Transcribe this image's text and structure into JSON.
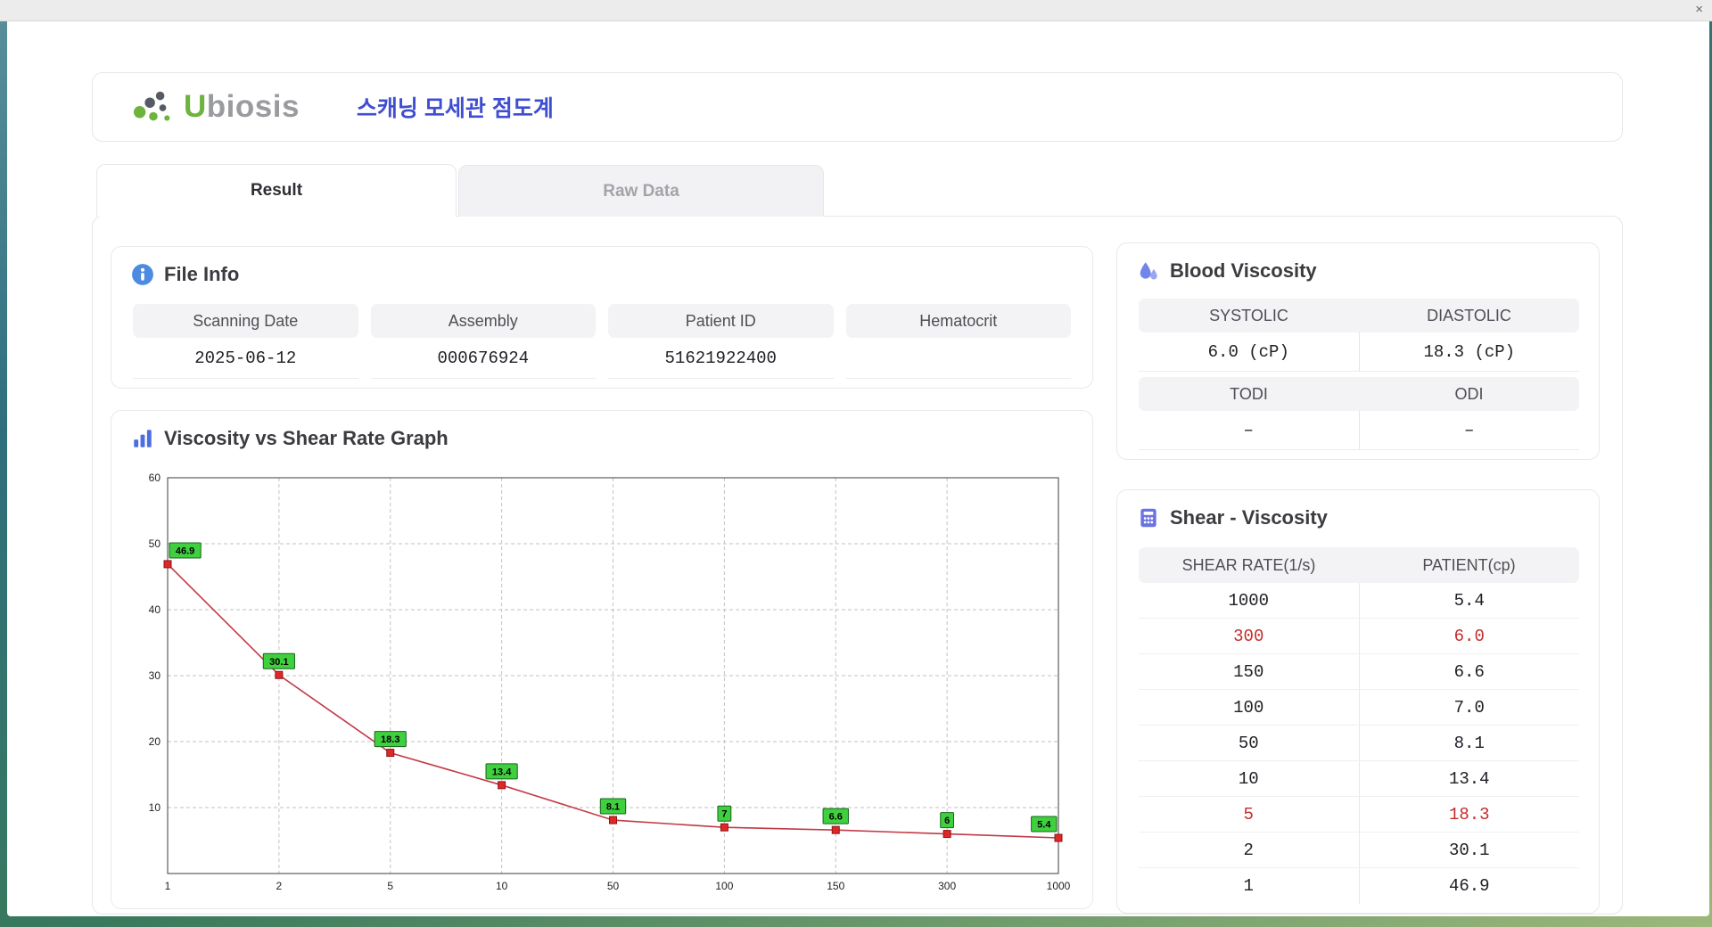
{
  "window": {
    "close_label": "×"
  },
  "header": {
    "logo_u": "U",
    "logo_rest": "biosis",
    "app_title": "스캐닝 모세관 점도계"
  },
  "tabs": {
    "result": "Result",
    "raw_data": "Raw Data"
  },
  "file_info": {
    "title": "File Info",
    "fields": [
      {
        "label": "Scanning Date",
        "value": "2025-06-12"
      },
      {
        "label": "Assembly",
        "value": "000676924"
      },
      {
        "label": "Patient ID",
        "value": "51621922400"
      },
      {
        "label": "Hematocrit",
        "value": ""
      }
    ]
  },
  "blood_viscosity": {
    "title": "Blood Viscosity",
    "cells": [
      {
        "label": "SYSTOLIC",
        "value": "6.0 (cP)"
      },
      {
        "label": "DIASTOLIC",
        "value": "18.3 (cP)"
      },
      {
        "label": "TODI",
        "value": "–"
      },
      {
        "label": "ODI",
        "value": "–"
      }
    ]
  },
  "graph_section": {
    "title": "Viscosity vs Shear Rate Graph"
  },
  "shear_viscosity": {
    "title": "Shear - Viscosity",
    "columns": [
      "SHEAR RATE(1/s)",
      "PATIENT(cp)"
    ],
    "rows": [
      {
        "shear": "1000",
        "patient": "5.4",
        "highlight": false
      },
      {
        "shear": "300",
        "patient": "6.0",
        "highlight": true
      },
      {
        "shear": "150",
        "patient": "6.6",
        "highlight": false
      },
      {
        "shear": "100",
        "patient": "7.0",
        "highlight": false
      },
      {
        "shear": "50",
        "patient": "8.1",
        "highlight": false
      },
      {
        "shear": "10",
        "patient": "13.4",
        "highlight": false
      },
      {
        "shear": "5",
        "patient": "18.3",
        "highlight": true
      },
      {
        "shear": "2",
        "patient": "30.1",
        "highlight": false
      },
      {
        "shear": "1",
        "patient": "46.9",
        "highlight": false
      }
    ]
  },
  "chart_data": {
    "type": "line",
    "title": "Viscosity vs Shear Rate Graph",
    "x_scale": "categorical",
    "x_categories": [
      "1",
      "2",
      "5",
      "10",
      "50",
      "100",
      "150",
      "300",
      "1000"
    ],
    "values": [
      46.9,
      30.1,
      18.3,
      13.4,
      8.1,
      7,
      6.6,
      6,
      5.4
    ],
    "point_labels": [
      "46.9",
      "30.1",
      "18.3",
      "13.4",
      "8.1",
      "7",
      "6.6",
      "6",
      "5.4"
    ],
    "ylim": [
      0,
      60
    ],
    "yticks": [
      10,
      20,
      30,
      40,
      50,
      60
    ],
    "grid": "dashed",
    "legend": "none",
    "line_color": "#c13a46",
    "marker": "square",
    "marker_color": "#e02727",
    "marker_edge": "#8c1418",
    "label_bg": "#3fcf3f",
    "label_edge": "#17651c"
  },
  "colors": {
    "accent_blue": "#3f4ed0",
    "logo_green": "#6db43f",
    "highlight_red": "#c52b2b",
    "header_gray": "#f3f3f5"
  }
}
